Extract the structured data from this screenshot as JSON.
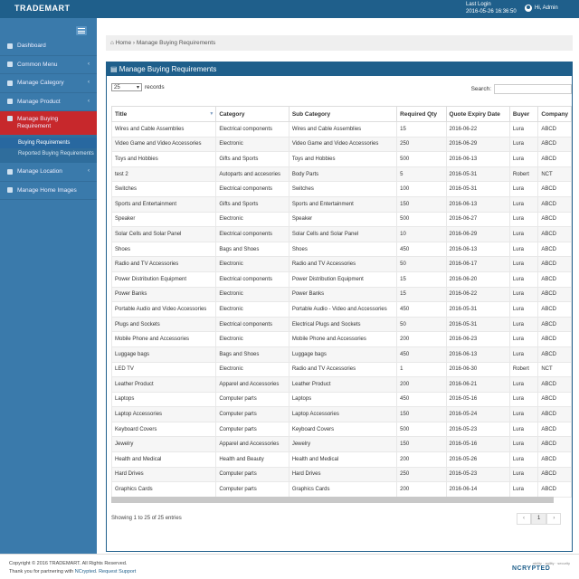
{
  "app": {
    "brand": "TRADEMART",
    "last_login_label": "Last Login",
    "last_login_time": "2016-05-26 16:36:50",
    "user": "Hi, Admin"
  },
  "sidebar": {
    "items": [
      {
        "label": "Dashboard",
        "chev": ""
      },
      {
        "label": "Common Menu",
        "chev": "‹"
      },
      {
        "label": "Manage Category",
        "chev": "‹"
      },
      {
        "label": "Manage Product",
        "chev": "‹"
      },
      {
        "label": "Manage Buying Requirement",
        "chev": ""
      },
      {
        "label": "Manage Location",
        "chev": "‹"
      },
      {
        "label": "Manage Home Images",
        "chev": ""
      }
    ],
    "sub": [
      "Buying Requirements",
      "Reported Buying Requirements"
    ]
  },
  "breadcrumb": {
    "home": "Home",
    "current": "Manage Buying Requirements"
  },
  "panel": {
    "title": "Manage Buying Requirements",
    "length_value": "25",
    "length_suffix": "records",
    "search_label": "Search:",
    "info": "Showing 1 to 25 of 25 entries",
    "pager": [
      "‹",
      "1",
      "›"
    ]
  },
  "table": {
    "headers": [
      "Title",
      "Category",
      "Sub Category",
      "Required Qty",
      "Quote Expiry Date",
      "Buyer",
      "Company"
    ],
    "rows": [
      [
        "Wires and Cable Assemblies",
        "Electrical components",
        "Wires and Cable Assemblies",
        "15",
        "2016-06-22",
        "Lura",
        "ABCD"
      ],
      [
        "Video Game and Video Accessories",
        "Electronic",
        "Video Game and Video Accessories",
        "250",
        "2016-06-29",
        "Lura",
        "ABCD"
      ],
      [
        "Toys and Hobbies",
        "Gifts and Sports",
        "Toys and Hobbies",
        "500",
        "2016-06-13",
        "Lura",
        "ABCD"
      ],
      [
        "test 2",
        "Autoparts and accesories",
        "Body Parts",
        "5",
        "2016-05-31",
        "Robert",
        "NCT"
      ],
      [
        "Switches",
        "Electrical components",
        "Switches",
        "100",
        "2016-05-31",
        "Lura",
        "ABCD"
      ],
      [
        "Sports and Entertainment",
        "Gifts and Sports",
        "Sports and Entertainment",
        "150",
        "2016-06-13",
        "Lura",
        "ABCD"
      ],
      [
        "Speaker",
        "Electronic",
        "Speaker",
        "500",
        "2016-06-27",
        "Lura",
        "ABCD"
      ],
      [
        "Solar Cells and Solar Panel",
        "Electrical components",
        "Solar Cells and Solar Panel",
        "10",
        "2016-06-29",
        "Lura",
        "ABCD"
      ],
      [
        "Shoes",
        "Bags and Shoes",
        "Shoes",
        "450",
        "2016-06-13",
        "Lura",
        "ABCD"
      ],
      [
        "Radio and TV Accessories",
        "Electronic",
        "Radio and TV Accessories",
        "50",
        "2016-06-17",
        "Lura",
        "ABCD"
      ],
      [
        "Power Distribution Equipment",
        "Electrical components",
        "Power Distribution Equipment",
        "15",
        "2016-06-20",
        "Lura",
        "ABCD"
      ],
      [
        "Power Banks",
        "Electronic",
        "Power Banks",
        "15",
        "2016-06-22",
        "Lura",
        "ABCD"
      ],
      [
        "Portable Audio and Video Accessories",
        "Electronic",
        "Portable Audio - Video and Accessories",
        "450",
        "2016-05-31",
        "Lura",
        "ABCD"
      ],
      [
        "Plugs and Sockets",
        "Electrical components",
        "Electrical Plugs and Sockets",
        "50",
        "2016-05-31",
        "Lura",
        "ABCD"
      ],
      [
        "Mobile Phone and Accessories",
        "Electronic",
        "Mobile Phone and Accessories",
        "200",
        "2016-06-23",
        "Lura",
        "ABCD"
      ],
      [
        "Luggage bags",
        "Bags and Shoes",
        "Luggage bags",
        "450",
        "2016-06-13",
        "Lura",
        "ABCD"
      ],
      [
        "LED TV",
        "Electronic",
        "Radio and TV Accessories",
        "1",
        "2016-06-30",
        "Robert",
        "NCT"
      ],
      [
        "Leather Product",
        "Apparel and Accessories",
        "Leather Product",
        "200",
        "2016-06-21",
        "Lura",
        "ABCD"
      ],
      [
        "Laptops",
        "Computer parts",
        "Laptops",
        "450",
        "2016-05-16",
        "Lura",
        "ABCD"
      ],
      [
        "Laptop Accessories",
        "Computer parts",
        "Laptop Accessories",
        "150",
        "2016-05-24",
        "Lura",
        "ABCD"
      ],
      [
        "Keyboard Covers",
        "Computer parts",
        "Keyboard Covers",
        "500",
        "2016-05-23",
        "Lura",
        "ABCD"
      ],
      [
        "Jewelry",
        "Apparel and Accessories",
        "Jewelry",
        "150",
        "2016-05-16",
        "Lura",
        "ABCD"
      ],
      [
        "Health and Medical",
        "Health and Beauty",
        "Health and Medical",
        "200",
        "2016-05-26",
        "Lura",
        "ABCD"
      ],
      [
        "Hard Drives",
        "Computer parts",
        "Hard Drives",
        "250",
        "2016-05-23",
        "Lura",
        "ABCD"
      ],
      [
        "Graphics Cards",
        "Computer parts",
        "Graphics Cards",
        "200",
        "2016-06-14",
        "Lura",
        "ABCD"
      ]
    ]
  },
  "footer": {
    "copyright": "Copyright © 2016 TRADEMART. All Rights Reserved.",
    "thanks_prefix": "Thank you for partnering with",
    "partner": "NCrypted",
    "support": "Request Support",
    "badge_small": "ability · agility · security",
    "badge": "NCRYPTED"
  }
}
